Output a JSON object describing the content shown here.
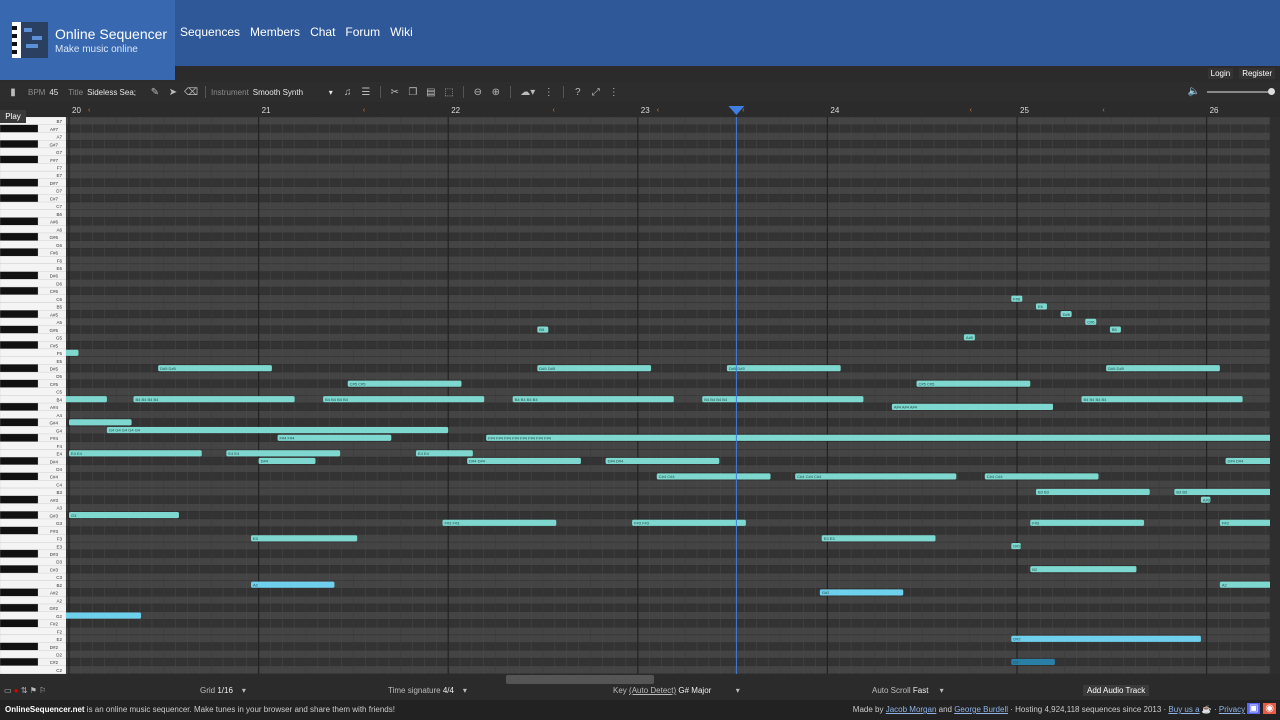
{
  "header": {
    "title": "Online Sequencer",
    "subtitle": "Make music online",
    "nav": [
      "Sequences",
      "Members",
      "Chat",
      "Forum",
      "Wiki"
    ]
  },
  "auth": {
    "login": "Login",
    "register": "Register"
  },
  "toolbar": {
    "bpm_label": "BPM",
    "bpm_value": "45",
    "title_label": "Title",
    "title_value": "Sideless Sea;",
    "instrument_label": "Instrument",
    "instrument_value": "Smooth Synth"
  },
  "play_label": "Play",
  "ruler": {
    "bars": [
      "20",
      "21",
      "22",
      "23",
      "24",
      "25",
      "26"
    ]
  },
  "piano_labels": [
    "B7",
    "A#7",
    "A7",
    "G#7",
    "G7",
    "F#7",
    "F7",
    "E7",
    "D#7",
    "D7",
    "C#7",
    "C7",
    "B6",
    "A#6",
    "A6",
    "G#6",
    "G6",
    "F#6",
    "F6",
    "E6",
    "D#6",
    "D6",
    "C#6",
    "C6",
    "B5",
    "A#5",
    "A5",
    "G#5",
    "G5",
    "F#5",
    "F5",
    "E5",
    "D#5",
    "D5",
    "C#5",
    "C5",
    "B4",
    "A#4",
    "A4",
    "G#4",
    "G4",
    "F#4",
    "F4",
    "E4",
    "D#4",
    "D4",
    "C#4",
    "C4",
    "B3",
    "A#3",
    "A3",
    "G#3",
    "G3",
    "F#3",
    "F3",
    "E3",
    "D#3",
    "D3",
    "C#3",
    "C3",
    "B2",
    "A#2",
    "A2",
    "G#2",
    "G2",
    "F#2",
    "F2",
    "E2",
    "D#2",
    "D2",
    "C#2",
    "C2"
  ],
  "notes": [
    {
      "row": 30,
      "start": -0.2,
      "len": 0.25,
      "label": ""
    },
    {
      "row": 32,
      "start": 0.47,
      "len": 0.6,
      "label": "D#5 D#5"
    },
    {
      "row": 32,
      "start": 2.47,
      "len": 0.6,
      "label": "D#5 D#5"
    },
    {
      "row": 32,
      "start": 3.47,
      "len": 0.6,
      "label": "D#5 D#5"
    },
    {
      "row": 32,
      "start": 5.47,
      "len": 0.6,
      "label": "D#5 D#5"
    },
    {
      "row": 34,
      "start": 1.47,
      "len": 0.6,
      "label": "C#5 C#5"
    },
    {
      "row": 34,
      "start": 4.47,
      "len": 0.6,
      "label": "C#5 C#5"
    },
    {
      "row": 36,
      "start": -0.2,
      "len": 0.4,
      "label": ""
    },
    {
      "row": 36,
      "start": 0.34,
      "len": 0.85,
      "label": "B4 B4 B4 B4"
    },
    {
      "row": 36,
      "start": 1.34,
      "len": 0.85,
      "label": "B4 B4 B4 B4"
    },
    {
      "row": 36,
      "start": 2.34,
      "len": 0.85,
      "label": "B4 B4 B4 B4"
    },
    {
      "row": 36,
      "start": 3.34,
      "len": 0.85,
      "label": "B4 B4 B4 B4"
    },
    {
      "row": 36,
      "start": 5.34,
      "len": 0.85,
      "label": "B4 B4 B4 B4"
    },
    {
      "row": 37,
      "start": 4.34,
      "len": 0.85,
      "label": "A#4 A#4 A#4"
    },
    {
      "row": 39,
      "start": 0.0,
      "len": 0.33,
      "label": ""
    },
    {
      "row": 40,
      "start": 0.2,
      "len": 1.8,
      "label": "G4 G4 G4 G4 G4"
    },
    {
      "row": 41,
      "start": 1.1,
      "len": 0.6,
      "label": "F#4 F#4"
    },
    {
      "row": 41,
      "start": 2.2,
      "len": 4.2,
      "label": "F#4 F#4 F#4 F#4 F#4 F#4 F#4 F#4"
    },
    {
      "row": 43,
      "start": 0.0,
      "len": 0.7,
      "label": "E4 E4"
    },
    {
      "row": 43,
      "start": 0.83,
      "len": 0.6,
      "label": "E4 E4"
    },
    {
      "row": 43,
      "start": 1.83,
      "len": 0.3,
      "label": "E4 E4"
    },
    {
      "row": 44,
      "start": 1.0,
      "len": 0.3,
      "label": "D#4"
    },
    {
      "row": 44,
      "start": 2.1,
      "len": 0.6,
      "label": "D#4 D#4"
    },
    {
      "row": 44,
      "start": 2.83,
      "len": 0.6,
      "label": "D#4 D#4"
    },
    {
      "row": 44,
      "start": 6.1,
      "len": 0.6,
      "label": "D#4 D#4"
    },
    {
      "row": 46,
      "start": 3.1,
      "len": 0.6,
      "label": "C#4 C#4"
    },
    {
      "row": 46,
      "start": 3.83,
      "len": 0.85,
      "label": "C#4 C#4 C#4"
    },
    {
      "row": 46,
      "start": 4.83,
      "len": 0.6,
      "label": "C#4 C#4"
    },
    {
      "row": 48,
      "start": 5.1,
      "len": 0.6,
      "label": "B3 B3"
    },
    {
      "row": 48,
      "start": 5.83,
      "len": 0.6,
      "label": "B3 B3"
    },
    {
      "row": 49,
      "start": 5.97,
      "len": 0.05,
      "label": "A#3"
    },
    {
      "row": 51,
      "start": 0.0,
      "len": 0.58,
      "label": "G3"
    },
    {
      "row": 52,
      "start": 1.97,
      "len": 0.6,
      "label": "F#3 F#3"
    },
    {
      "row": 52,
      "start": 2.97,
      "len": 0.6,
      "label": "F#3 F#3"
    },
    {
      "row": 52,
      "start": 5.07,
      "len": 0.6,
      "label": "F#3"
    },
    {
      "row": 52,
      "start": 6.07,
      "len": 0.6,
      "label": "F#3"
    },
    {
      "row": 54,
      "start": 0.96,
      "len": 0.56,
      "label": "E3"
    },
    {
      "row": 54,
      "start": 3.97,
      "len": 0.6,
      "label": "E3 E3"
    },
    {
      "row": 55,
      "start": 4.97,
      "len": 0.05,
      "label": "D#3"
    },
    {
      "row": 58,
      "start": 5.07,
      "len": 0.56,
      "label": "B2"
    },
    {
      "row": 60,
      "start": 0.96,
      "len": 0.44,
      "label": "A2",
      "bright": true
    },
    {
      "row": 60,
      "start": 6.07,
      "len": 0.44,
      "label": "A2"
    },
    {
      "row": 61,
      "start": 3.96,
      "len": 0.44,
      "label": "G#2",
      "bright": true
    },
    {
      "row": 64,
      "start": -0.2,
      "len": 0.58,
      "label": "",
      "bright": true
    },
    {
      "row": 67,
      "start": 4.97,
      "len": 1.0,
      "label": "D#2",
      "bright": true
    },
    {
      "row": 70,
      "start": 4.97,
      "len": 0.23,
      "label": "C2",
      "dark": true
    }
  ],
  "single_notes": [
    {
      "row": 23,
      "start": 4.97,
      "label": "F#6"
    },
    {
      "row": 24,
      "start": 5.1,
      "label": "E6"
    },
    {
      "row": 25,
      "start": 5.23,
      "label": "D#6"
    },
    {
      "row": 26,
      "start": 5.36,
      "label": "C#6"
    },
    {
      "row": 27,
      "start": 2.47,
      "label": "B5"
    },
    {
      "row": 27,
      "start": 5.49,
      "label": "B5"
    },
    {
      "row": 28,
      "start": 4.72,
      "label": "A#5"
    }
  ],
  "bottom": {
    "grid_label": "Grid",
    "grid_value": "1/16",
    "time_sig_label": "Time signature",
    "time_sig_value": "4/4",
    "key_label": "Key",
    "key_auto": "(Auto Detect)",
    "key_value": "G# Major",
    "autoscroll_label": "Auto Scroll",
    "autoscroll_value": "Fast",
    "add_audio_track": "Add Audio Track"
  },
  "footer": {
    "site": "OnlineSequencer.net",
    "tagline": " is an online music sequencer. Make tunes in your browser and share them with friends!",
    "made_by": "Made by ",
    "author1": "Jacob Morgan",
    "and": " and ",
    "author2": "George Burdell",
    "hosting": " · Hosting 4,924,118 sequences since 2013 · ",
    "buy": "Buy us a",
    "sep": " · ",
    "privacy": "Privacy",
    "sep2": " · "
  },
  "colors": {
    "note": "#7ed8cf",
    "note_bright": "#6fd0ee",
    "header": "#2f5899",
    "logo_bg": "#3868b0",
    "playhead": "#3f7fe0"
  }
}
